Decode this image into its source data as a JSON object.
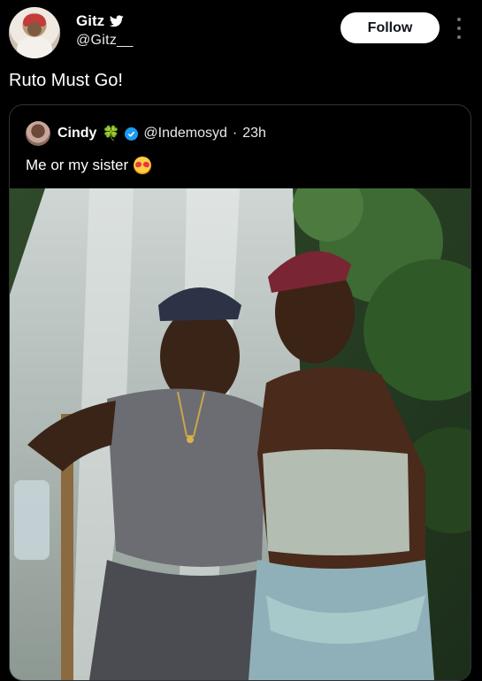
{
  "author": {
    "display_name": "Gitz",
    "handle": "@Gitz__",
    "avatar_icon": "profile-photo",
    "badge_icon": "twitter-bird-icon"
  },
  "follow_button": {
    "label": "Follow"
  },
  "more_icon": "more-vertical-icon",
  "tweet": {
    "text": "Ruto Must Go!"
  },
  "quoted": {
    "display_name": "Cindy",
    "name_emoji": "🍀",
    "verified_icon": "verified-badge-icon",
    "handle": "@Indemosyd",
    "separator": "·",
    "time": "23h",
    "text": "Me or my sister",
    "text_emoji_icon": "smiling-face-with-hearts-icon",
    "media": "photo"
  },
  "colors": {
    "background": "#000000",
    "text": "#e7e9ea",
    "follow_bg": "#ffffff",
    "verified": "#1d9bf0",
    "border": "#2f3336"
  }
}
